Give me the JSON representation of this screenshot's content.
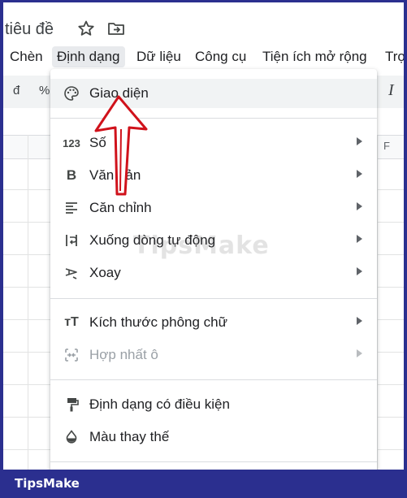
{
  "doc": {
    "title": "tiêu đề",
    "star_icon": "star-icon",
    "move_icon": "folder-move-icon"
  },
  "menubar": {
    "items": [
      "Chèn",
      "Định dạng",
      "Dữ liệu",
      "Công cụ",
      "Tiện ích mở rộng",
      "Trợ"
    ],
    "active": "Định dạng"
  },
  "toolbar": {
    "currency": "đ",
    "percent": "%",
    "italic": "I"
  },
  "grid": {
    "column_f": "F"
  },
  "format_menu": {
    "items": [
      {
        "label": "Giao diện",
        "icon": "palette-icon",
        "submenu": false,
        "disabled": false
      },
      {
        "label": "Số",
        "icon": "number-123-icon",
        "icon_text": "123",
        "submenu": true,
        "disabled": false
      },
      {
        "label": "Văn bản",
        "icon": "bold-icon",
        "icon_text": "B",
        "submenu": true,
        "disabled": false
      },
      {
        "label": "Căn chỉnh",
        "icon": "align-left-icon",
        "submenu": true,
        "disabled": false
      },
      {
        "label": "Xuống dòng tự động",
        "icon": "text-wrap-icon",
        "submenu": true,
        "disabled": false
      },
      {
        "label": "Xoay",
        "icon": "text-rotate-icon",
        "submenu": true,
        "disabled": false
      },
      {
        "label": "Kích thước phông chữ",
        "icon": "font-size-icon",
        "icon_text": "тT",
        "submenu": true,
        "disabled": false
      },
      {
        "label": "Hợp nhất ô",
        "icon": "merge-cells-icon",
        "submenu": true,
        "disabled": true
      },
      {
        "label": "Định dạng có điều kiện",
        "icon": "paint-roller-icon",
        "submenu": false,
        "disabled": false
      },
      {
        "label": "Màu thay thế",
        "icon": "color-drop-icon",
        "submenu": false,
        "disabled": false
      }
    ]
  },
  "watermark": "TipsMake",
  "footer": {
    "brand": "TipsMake"
  },
  "colors": {
    "frame": "#2b2f8f",
    "arrow": "#d0121b",
    "menu_hover": "#f1f3f4"
  }
}
